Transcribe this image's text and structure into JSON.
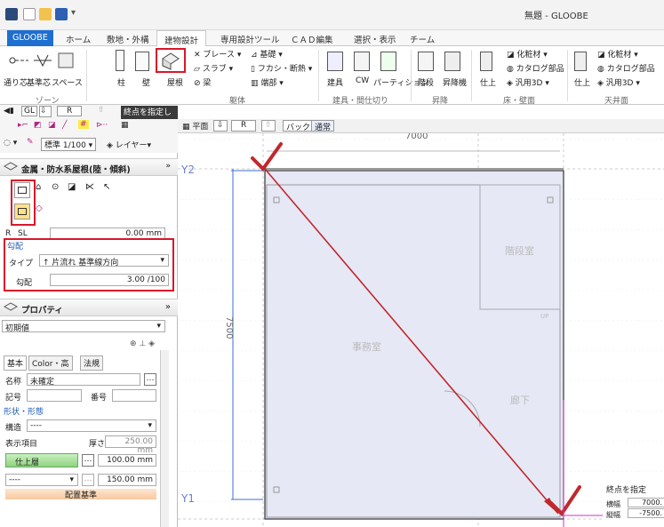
{
  "app": {
    "title": "無題 - GLOOBE"
  },
  "ribbon_tabs": [
    "GLOOBE",
    "ホーム",
    "敷地・外構",
    "建物設計",
    "専用設計ツール",
    "ＣＡＤ編集",
    "選択・表示",
    "チーム"
  ],
  "ribbon": {
    "zone": {
      "items": [
        "通り芯",
        "基準芯",
        "スペース"
      ],
      "group": "ゾーン"
    },
    "body": {
      "items": [
        "柱",
        "壁",
        "屋根",
        "ブレース",
        "スラブ",
        "梁",
        "基礎",
        "フカシ・断熱",
        "端部"
      ],
      "group": "躯体"
    },
    "fittings": {
      "items": [
        "建具",
        "CW",
        "パーティション"
      ],
      "group": "建具・間仕切り"
    },
    "lift": {
      "items": [
        "階段",
        "昇降機"
      ],
      "group": "昇降"
    },
    "floor": {
      "items": [
        "仕上",
        "化粧材",
        "カタログ部品",
        "汎用3D"
      ],
      "group": "床・壁面"
    },
    "ceiling": {
      "items": [
        "仕上",
        "化粧材",
        "カタログ部品",
        "汎用3D"
      ],
      "group": "天井面"
    }
  },
  "hint": {
    "level": "GL",
    "r": "R",
    "message": "終点を指定してください。"
  },
  "toolbar2": {
    "scale": "標準 1/100",
    "layer": "レイヤー"
  },
  "roof_panel": {
    "title": "金属・防水系屋根(陸・傾斜)",
    "r_label": "R",
    "sl_label": "SL",
    "sl_value": "0.00",
    "sl_unit": "mm"
  },
  "slope": {
    "title": "勾配",
    "type_label": "タイプ",
    "type_value": "片流れ 基準線方向",
    "slope_label": "勾配",
    "slope_value": "3.00",
    "slope_unit": "/100"
  },
  "props": {
    "title": "プロパティ",
    "preset": "初期値",
    "tabs": [
      "基本",
      "Color・高",
      "法規"
    ],
    "name_label": "名称",
    "name_value": "未確定",
    "code_label": "記号",
    "num_label": "番号",
    "shape_section": "形状・形態",
    "struct_label": "構造",
    "struct_value": "----",
    "display_label": "表示項目",
    "thickness_label": "厚さ",
    "thickness_value": "250.00",
    "thickness_unit": "mm",
    "finish_label": "仕上層",
    "finish_value": "100.00",
    "finish_unit": "mm",
    "layer2_value": "----",
    "layer2_size": "150.00",
    "layer2_unit": "mm",
    "base_label": "配置基準"
  },
  "view": {
    "plane": "平面",
    "r": "R",
    "back": "バック",
    "normal": "通常"
  },
  "drawing": {
    "dim_top": "7000",
    "dim_left": "7500",
    "axis_y2": "Y2",
    "axis_y1": "Y1",
    "room1": "階段室",
    "room2": "事務室",
    "room3": "廊下",
    "up_label": "UP",
    "end_title": "終点を指定",
    "w_label": "横幅",
    "w_value": "7000.",
    "h_label": "縦幅",
    "h_value": "-7500."
  },
  "colors": {
    "accent": "#1f6fd1",
    "highlight": "#d9172a",
    "roof_fill": "#e6e8f5",
    "guide": "#cc33cc"
  }
}
